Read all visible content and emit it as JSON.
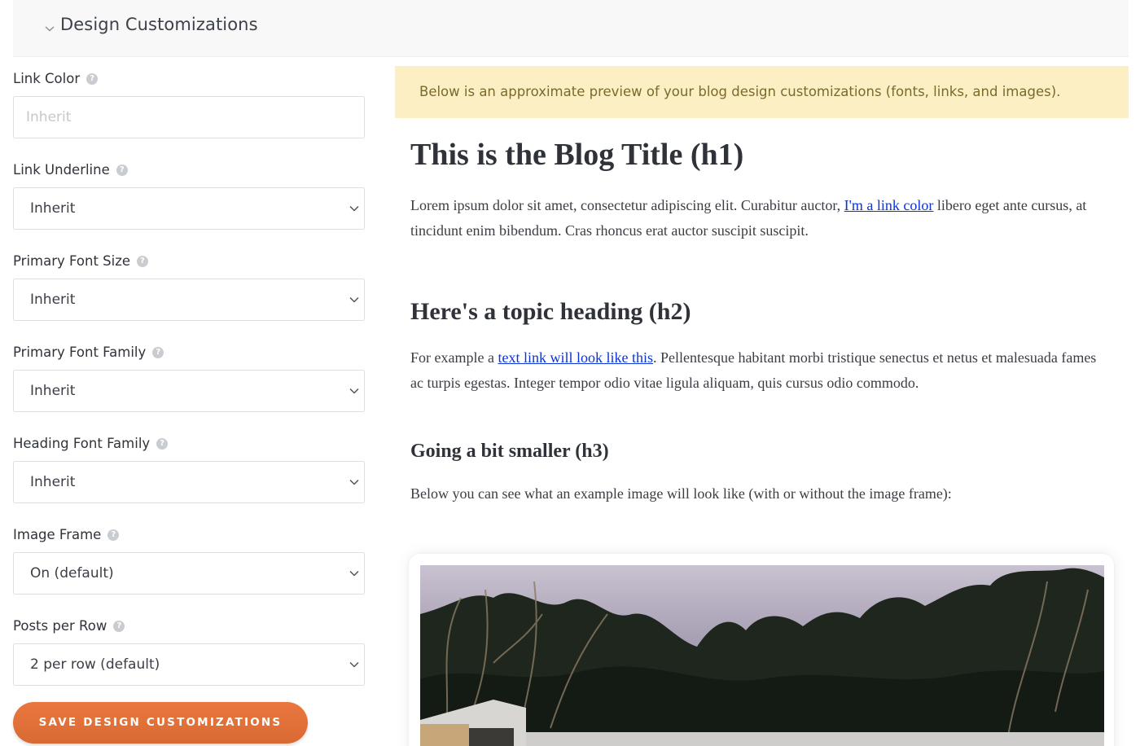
{
  "section": {
    "title": "Design Customizations"
  },
  "fields": [
    {
      "label": "Link Color",
      "kind": "input",
      "value": "",
      "placeholder": "Inherit"
    },
    {
      "label": "Link Underline",
      "kind": "select",
      "value": "Inherit"
    },
    {
      "label": "Primary Font Size",
      "kind": "select",
      "value": "Inherit"
    },
    {
      "label": "Primary Font Family",
      "kind": "select",
      "value": "Inherit"
    },
    {
      "label": "Heading Font Family",
      "kind": "select",
      "value": "Inherit"
    },
    {
      "label": "Image Frame",
      "kind": "select",
      "value": "On (default)"
    },
    {
      "label": "Posts per Row",
      "kind": "select",
      "value": "2 per row (default)"
    }
  ],
  "help_icon_glyph": "?",
  "save_button": {
    "label": "SAVE DESIGN CUSTOMIZATIONS"
  },
  "preview": {
    "notice": "Below is an approximate preview of your blog design customizations (fonts, links, and images).",
    "h1": "This is the Blog Title (h1)",
    "p1_before": "Lorem ipsum dolor sit amet, consectetur adipiscing elit. Curabitur auctor, ",
    "p1_link": "I'm a link color",
    "p1_after": " libero eget ante cursus, at tincidunt enim bibendum. Cras rhoncus erat auctor suscipit suscipit.",
    "h2": "Here's a topic heading (h2)",
    "p2_before": "For example a ",
    "p2_link": "text link will look like this",
    "p2_after": ". Pellentesque habitant morbi tristique senectus et netus et malesuada fames ac turpis egestas. Integer tempor odio vitae ligula aliquam, quis cursus odio commodo.",
    "h3": "Going a bit smaller (h3)",
    "p3": "Below you can see what an example image will look like (with or without the image frame):"
  },
  "colors": {
    "accent": "#e36f38",
    "notice_bg": "#fcefc4",
    "notice_text": "#7b6a2a",
    "link": "#0b33d6"
  },
  "icons": {
    "section_toggle": "chevron-down-icon",
    "select_caret": "chevron-down-icon",
    "help": "help-icon"
  }
}
